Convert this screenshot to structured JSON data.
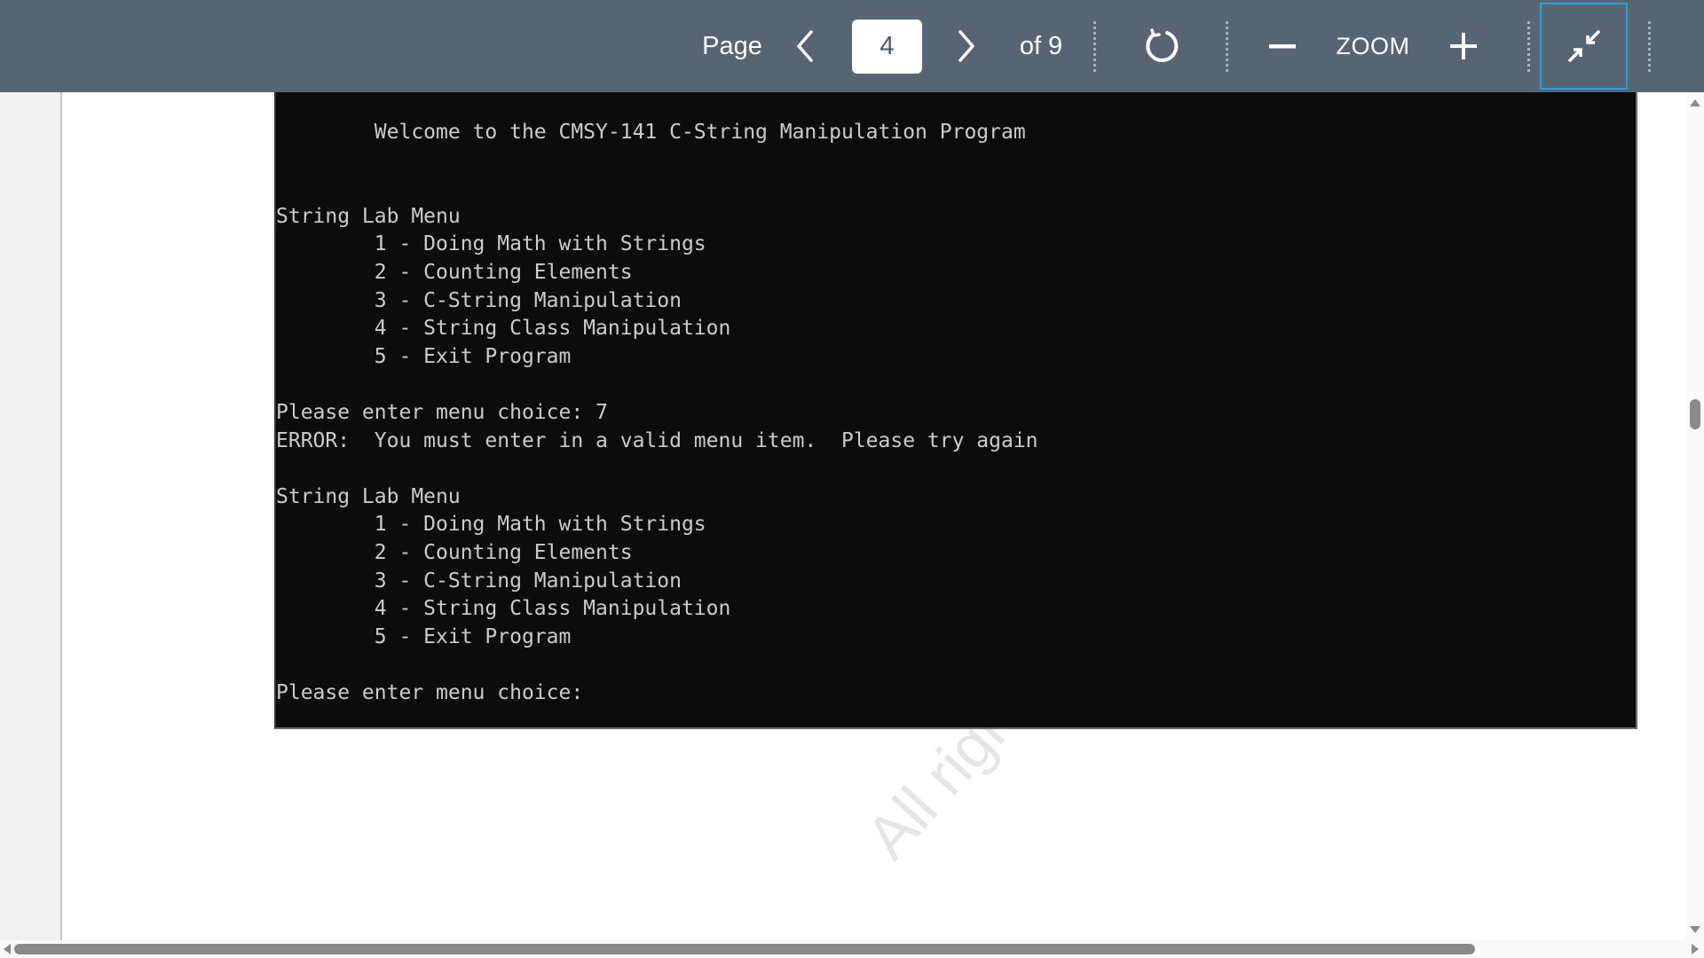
{
  "toolbar": {
    "page_label": "Page",
    "current_page": "4",
    "total_pages_label": "of 9",
    "zoom_label": "ZOOM",
    "icons": {
      "prev": "chevron-left-icon",
      "next": "chevron-right-icon",
      "rotate": "rotate-clockwise-icon",
      "zoom_out": "minus-icon",
      "zoom_in": "plus-icon",
      "exit_fullscreen": "exit-fullscreen-icon"
    },
    "colors": {
      "background": "#566573",
      "focus_border": "#2d9cdb"
    }
  },
  "document": {
    "watermark": "All rights reserved",
    "terminal": {
      "background": "#0c0c0c",
      "text_color": "#cccccc",
      "lines": [
        "        Welcome to the CMSY-141 C-String Manipulation Program",
        "",
        "",
        "String Lab Menu",
        "        1 - Doing Math with Strings",
        "        2 - Counting Elements",
        "        3 - C-String Manipulation",
        "        4 - String Class Manipulation",
        "        5 - Exit Program",
        "",
        "Please enter menu choice: 7",
        "ERROR:  You must enter in a valid menu item.  Please try again",
        "",
        "String Lab Menu",
        "        1 - Doing Math with Strings",
        "        2 - Counting Elements",
        "        3 - C-String Manipulation",
        "        4 - String Class Manipulation",
        "        5 - Exit Program",
        "",
        "Please enter menu choice: "
      ]
    }
  },
  "scrollbars": {
    "vertical_position_fraction": 0.37,
    "horizontal_visible_fraction": 0.87
  }
}
